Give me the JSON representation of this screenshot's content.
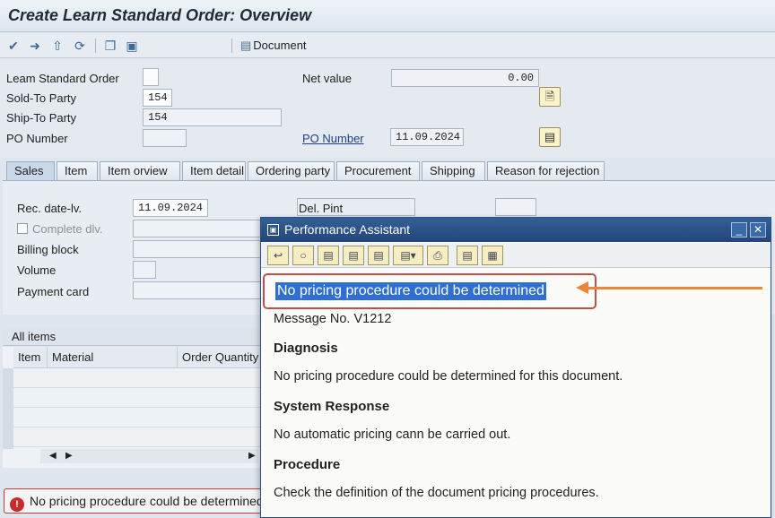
{
  "window": {
    "title": "Create Learn Standard Order: Overview"
  },
  "toolbar": {
    "icons": [
      "check-icon",
      "forward-arrow-icon",
      "up-icon",
      "refresh-icon",
      "copy-icon",
      "display-icon"
    ],
    "document_label": "Document"
  },
  "header": {
    "order_label": "Leam Standard Order",
    "order_value": "",
    "sold_to_label": "Sold-To Party",
    "sold_to_value": "154",
    "ship_to_label": "Ship-To Party",
    "ship_to_value": "154",
    "po_number_label": "PO Number",
    "po_number_value": "",
    "net_value_label": "Net value",
    "net_value_value": "0.00",
    "po_number_link": "PO Number",
    "po_date_value": "11.09.2024"
  },
  "tabs": [
    {
      "label": "Sales",
      "active": true
    },
    {
      "label": "Item",
      "active": false
    },
    {
      "label": "Item orview",
      "active": false
    },
    {
      "label": "Item detail",
      "active": false
    },
    {
      "label": "Ordering party",
      "active": false
    },
    {
      "label": "Procurement",
      "active": false
    },
    {
      "label": "Shipping",
      "active": false
    },
    {
      "label": "Reason for rejection",
      "active": false
    }
  ],
  "sales_tab": {
    "rec_date_label": "Rec. date-lv.",
    "rec_date_value": "11.09.2024",
    "complete_label": "Complete dlv.",
    "billing_block_label": "Billing block",
    "volume_label": "Volume",
    "payment_card_label": "Payment card",
    "del_pint_label": "Del. Pint"
  },
  "items": {
    "section_title": "All items",
    "columns": [
      "Item",
      "Material",
      "Order Quantity"
    ]
  },
  "status_bar": {
    "message": "No pricing procedure could be determined"
  },
  "performance_assistant": {
    "title": "Performance Assistant",
    "heading": "No pricing procedure could be determined",
    "message_no": "Message No. V1212",
    "diagnosis_title": "Diagnosis",
    "diagnosis_text": "No pricing procedure could be determined for this document.",
    "system_response_title": "System Response",
    "system_response_text": "No automatic pricing cann be carried out.",
    "procedure_title": "Procedure",
    "procedure_text": "Check the definition of the document pricing procedures."
  },
  "colors": {
    "highlight_box": "#c0504d",
    "selection": "#2e6fd1",
    "arrow": "#e8863a",
    "dialog_titlebar": "#23467a"
  }
}
